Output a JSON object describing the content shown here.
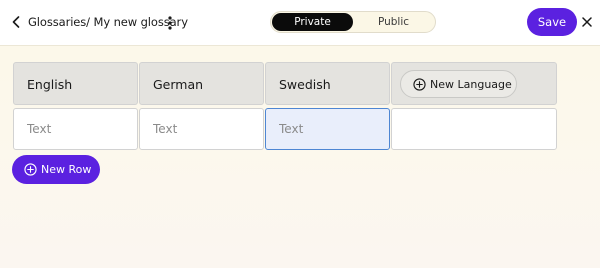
{
  "header": {
    "breadcrumb": "Glossaries/ My new glossary",
    "visibility_options": [
      "Private",
      "Public"
    ],
    "visibility_selected": "Private",
    "save_label": "Save"
  },
  "table": {
    "columns": [
      "English",
      "German",
      "Swedish"
    ],
    "new_language_label": "New Language",
    "rows": [
      {
        "cells": [
          "",
          "",
          ""
        ]
      }
    ],
    "cell_placeholder": "Text",
    "new_row_label": "New Row"
  },
  "colors": {
    "accent": "#5b21e0",
    "header_cell": "#e4e3df",
    "focus_border": "#4e86d3"
  },
  "icons": {
    "back": "chevron-left-icon",
    "menu": "kebab-menu-icon",
    "close": "close-icon",
    "add": "plus-circle-icon"
  }
}
